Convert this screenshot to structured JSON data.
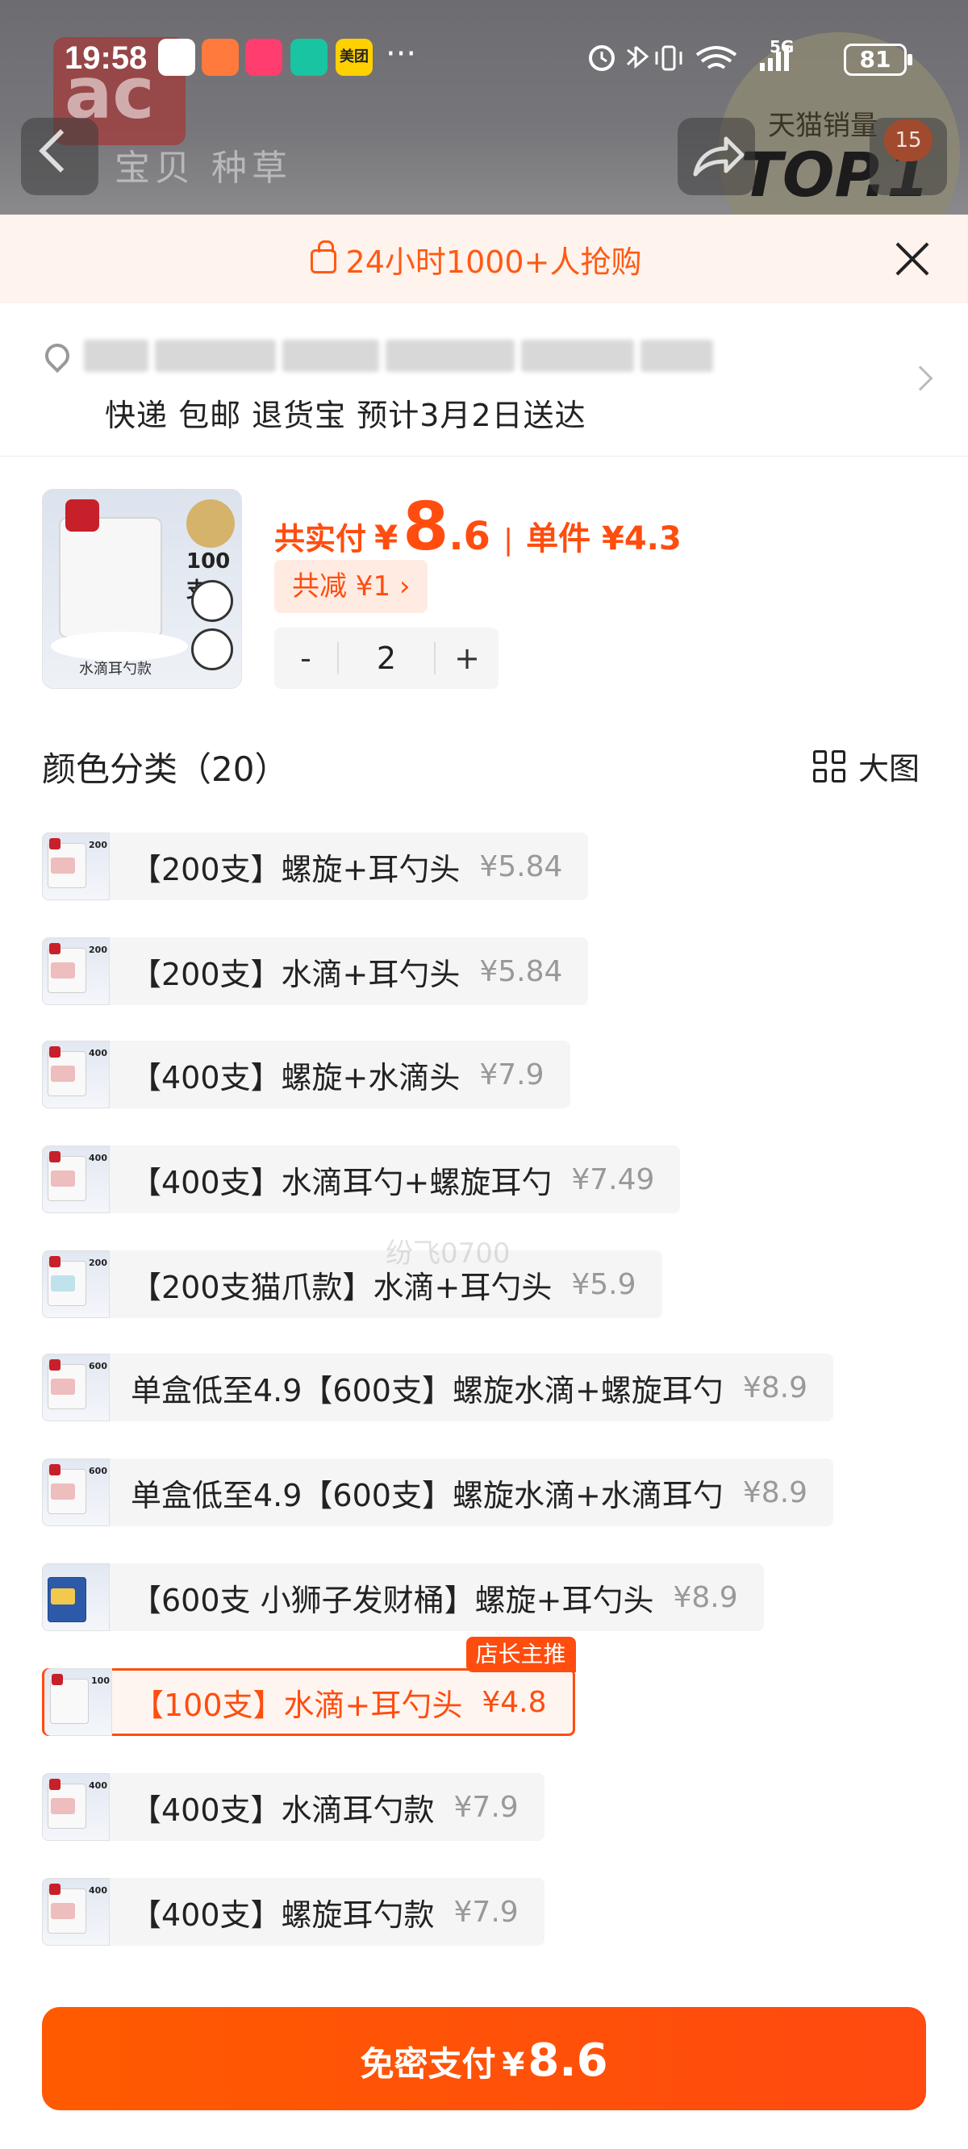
{
  "status_bar": {
    "time": "19:58",
    "network": "5G",
    "battery": "81",
    "app_icons": [
      "envelope-icon",
      "app-icon",
      "tmall-icon",
      "xiaomi-icon",
      "meituan-icon"
    ],
    "meituan_label": "美团",
    "more": "···"
  },
  "backdrop": {
    "logo_text": "ac",
    "title": "宝贝  种草",
    "sales_label": "天猫销量",
    "top_label": "TOP.1",
    "cart_count": "15"
  },
  "promo": {
    "text": "24小时1000+人抢购"
  },
  "address": {
    "delivery_line": "快递 包邮 退货宝 预计3月2日送达"
  },
  "product": {
    "thumb_count": "100支",
    "thumb_caption": "水滴耳勺款",
    "pay_label": "共实付",
    "currency": "¥",
    "pay_integer": "8",
    "pay_decimal": ".6",
    "separator": "|",
    "unit_price": "单件 ¥4.3",
    "discount": "共减 ¥1 ›"
  },
  "quantity": {
    "minus": "-",
    "value": "2",
    "plus": "+"
  },
  "options_section": {
    "title": "颜色分类（20）",
    "big_view": "大图"
  },
  "options": [
    {
      "label": "【200支】螺旋+耳勺头",
      "price": "¥5.84",
      "num": "200"
    },
    {
      "label": "【200支】水滴+耳勺头",
      "price": "¥5.84",
      "num": "200"
    },
    {
      "label": "【400支】螺旋+水滴头",
      "price": "¥7.9",
      "num": "400"
    },
    {
      "label": "【400支】水滴耳勺+螺旋耳勺",
      "price": "¥7.49",
      "num": "400"
    },
    {
      "label": "【200支猫爪款】水滴+耳勺头",
      "price": "¥5.9",
      "num": "200"
    },
    {
      "label": "单盒低至4.9【600支】螺旋水滴+螺旋耳勺",
      "price": "¥8.9",
      "num": "600"
    },
    {
      "label": "单盒低至4.9【600支】螺旋水滴+水滴耳勺",
      "price": "¥8.9",
      "num": "600"
    },
    {
      "label": "【600支 小狮子发财桶】螺旋+耳勺头",
      "price": "¥8.9",
      "num": ""
    },
    {
      "label": "【100支】水滴+耳勺头",
      "price": "¥4.8",
      "num": "100",
      "badge": "店长主推"
    },
    {
      "label": "【400支】水滴耳勺款",
      "price": "¥7.9",
      "num": "400"
    },
    {
      "label": "【400支】螺旋耳勺款",
      "price": "¥7.9",
      "num": "400"
    }
  ],
  "watermark": "纷飞0700",
  "pay_button": {
    "label": "免密支付",
    "currency": "¥",
    "amount": "8.6"
  },
  "colors": {
    "accent": "#ff4d0f",
    "promo_bg": "#fff3ee",
    "option_bg": "#f5f5f5"
  }
}
